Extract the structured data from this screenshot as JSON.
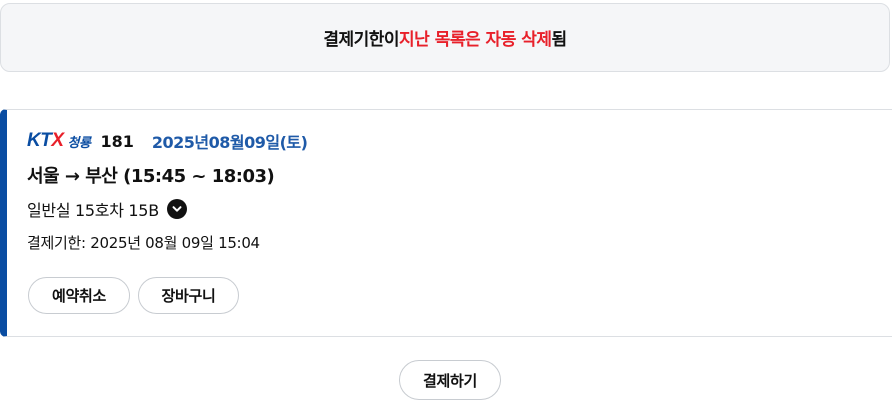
{
  "notice": {
    "prefix": "결제기한이 ",
    "highlight": "지난 목록은 자동 삭제",
    "suffix": "됨"
  },
  "reservation": {
    "logo": {
      "brand_k": "KT",
      "brand_x": "X",
      "line": "청룡"
    },
    "train_number": "181",
    "date": "2025년08월09일(토)",
    "route": "서울 → 부산 (15:45 ~ 18:03)",
    "seat": "일반실 15호차 15B",
    "deadline": "결제기한: 2025년 08월 09일 15:04",
    "buttons": {
      "cancel": "예약취소",
      "cart": "장바구니"
    }
  },
  "footer": {
    "pay_label": "결제하기"
  },
  "colors": {
    "brand_blue": "#0a4da2",
    "alert_red": "#e8202a",
    "date_blue": "#1f5aa8"
  },
  "icons": {
    "seat_toggle": "chevron-down-icon"
  }
}
